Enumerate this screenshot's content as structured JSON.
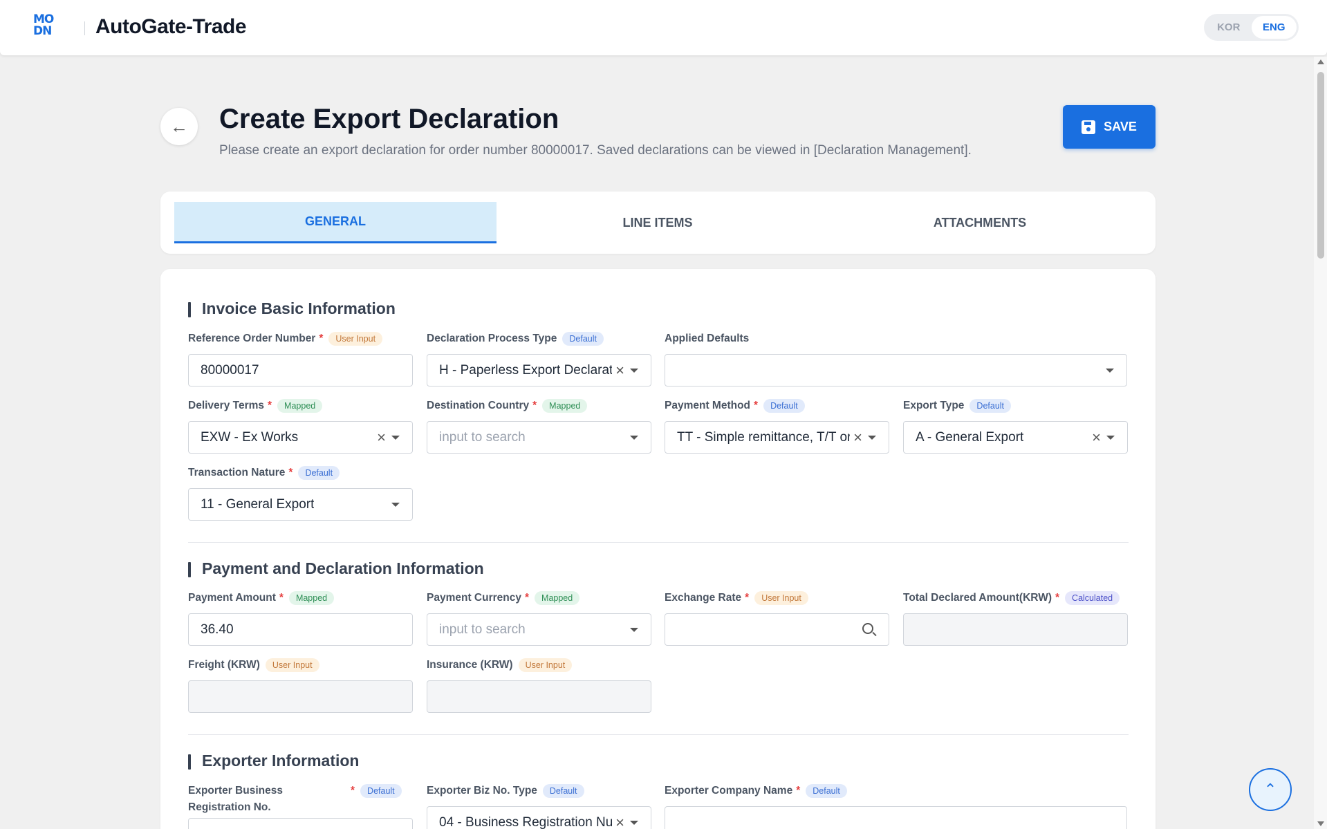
{
  "app": {
    "brand": "AutoGate-Trade",
    "logo_text_1": "MO",
    "logo_text_2": "DN",
    "lang_kor": "KOR",
    "lang_eng": "ENG",
    "active_lang": "ENG"
  },
  "page": {
    "title": "Create Export Declaration",
    "description": "Please create an export declaration for order number 80000017. Saved declarations can be viewed in [Declaration Management].",
    "save_label": "SAVE"
  },
  "tabs": [
    {
      "label": "GENERAL",
      "active": true
    },
    {
      "label": "LINE ITEMS",
      "active": false
    },
    {
      "label": "ATTACHMENTS",
      "active": false
    }
  ],
  "sections": {
    "invoice": {
      "title": "Invoice Basic Information"
    },
    "payment": {
      "title": "Payment and Declaration Information"
    },
    "exporter": {
      "title": "Exporter Information"
    }
  },
  "badges": {
    "user_input": "User Input",
    "default": "Default",
    "mapped": "Mapped",
    "calculated": "Calculated"
  },
  "fields": {
    "ref_order": {
      "label": "Reference Order Number",
      "value": "80000017"
    },
    "decl_process": {
      "label": "Declaration Process Type",
      "value": "H - Paperless Export Declarati··"
    },
    "applied_defaults": {
      "label": "Applied Defaults",
      "value": ""
    },
    "delivery_terms": {
      "label": "Delivery Terms",
      "value": "EXW - Ex Works"
    },
    "dest_country": {
      "label": "Destination Country",
      "placeholder": "input to search"
    },
    "payment_method": {
      "label": "Payment Method",
      "value": "TT - Simple remittance, T/T or··"
    },
    "export_type": {
      "label": "Export Type",
      "value": "A - General Export"
    },
    "transaction_nature": {
      "label": "Transaction Nature",
      "value": "11 - General Export"
    },
    "payment_amount": {
      "label": "Payment Amount",
      "value": "36.40"
    },
    "payment_currency": {
      "label": "Payment Currency",
      "placeholder": "input to search"
    },
    "exchange_rate": {
      "label": "Exchange Rate",
      "value": ""
    },
    "total_declared": {
      "label": "Total Declared Amount(KRW)",
      "value": ""
    },
    "freight": {
      "label": "Freight (KRW)",
      "value": ""
    },
    "insurance": {
      "label": "Insurance (KRW)",
      "value": ""
    },
    "exporter_brn": {
      "label": "Exporter Business Registration No."
    },
    "exporter_biz_type": {
      "label": "Exporter Biz No. Type",
      "value": "04 - Business Registration Nu··"
    },
    "exporter_company": {
      "label": "Exporter Company Name"
    }
  },
  "icons": {
    "clear": "×",
    "back": "←",
    "up": "⌃"
  },
  "colors": {
    "primary": "#1a6fe0",
    "required": "#e53e3e"
  }
}
